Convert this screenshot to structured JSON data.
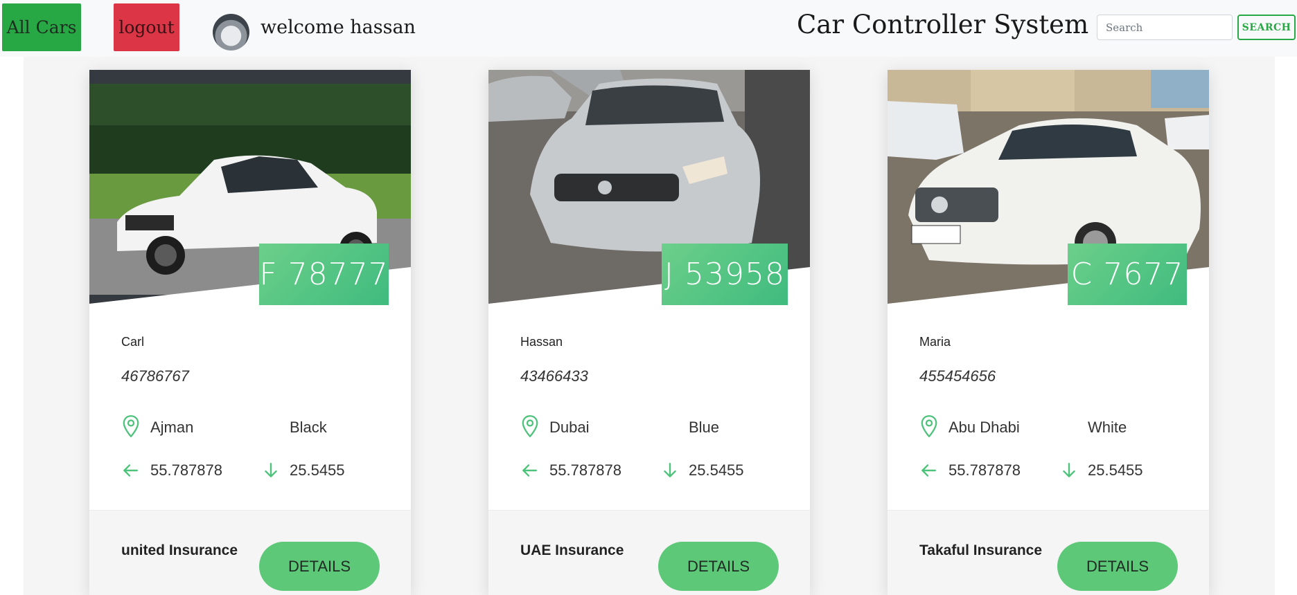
{
  "nav": {
    "all_cars_label": "All Cars",
    "logout_label": "logout",
    "welcome_text": "welcome hassan",
    "brand": "Car Controller System",
    "search_placeholder": "Search",
    "search_button_label": "SEARCH"
  },
  "colors": {
    "accent_green": "#5cc878",
    "success": "#28a745",
    "danger": "#dc3545"
  },
  "cards": [
    {
      "plate": "F 78777",
      "owner": "Carl",
      "phone": "46786767",
      "city": "Ajman",
      "color": "Black",
      "longitude": "55.787878",
      "latitude": "25.5455",
      "insurance": "united Insurance",
      "details_label": "DETAILS"
    },
    {
      "plate": "J 53958",
      "owner": "Hassan",
      "phone": "43466433",
      "city": "Dubai",
      "color": "Blue",
      "longitude": "55.787878",
      "latitude": "25.5455",
      "insurance": "UAE Insurance",
      "details_label": "DETAILS"
    },
    {
      "plate": "C 7677",
      "owner": "Maria",
      "phone": "455454656",
      "city": "Abu Dhabi",
      "color": "White",
      "longitude": "55.787878",
      "latitude": "25.5455",
      "insurance": "Takaful Insurance",
      "details_label": "DETAILS"
    }
  ]
}
